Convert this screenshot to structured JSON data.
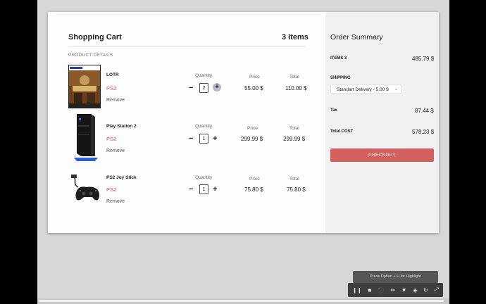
{
  "cart": {
    "title": "Shopping Cart",
    "items_count": "3 Items",
    "section_label": "PRODUCT DETAILS",
    "products": [
      {
        "name": "LOTR",
        "category": "PS2",
        "remove": "Remove",
        "quantity_label": "Quantity",
        "qty_minus": "−",
        "quantity": "2",
        "qty_plus": "+",
        "price_label": "Price",
        "price": "55.00 $",
        "total_label": "Total",
        "total": "110.00 $",
        "image_icon": "game-cover-image"
      },
      {
        "name": "Play Station 2",
        "category": "PS2",
        "remove": "Remove",
        "quantity_label": "Quantity",
        "qty_minus": "−",
        "quantity": "1",
        "qty_plus": "+",
        "price_label": "Price",
        "price": "299.99 $",
        "total_label": "Total",
        "total": "299.99 $",
        "image_icon": "console-image"
      },
      {
        "name": "PS2 Joy Stick",
        "category": "PS2",
        "remove": "Remove",
        "quantity_label": "Quantity",
        "qty_minus": "−",
        "quantity": "1",
        "qty_plus": "+",
        "price_label": "Price",
        "price": "75.80 $",
        "total_label": "Total",
        "total": "75.80 $",
        "image_icon": "controller-image"
      }
    ]
  },
  "summary": {
    "title": "Order Summary",
    "items_label": "ITEMS 3",
    "items_value": "485.79 $",
    "shipping_label": "SHIPPING",
    "shipping_option": "Standart Delivery - 5.00 $",
    "tax_label": "Tax",
    "tax_value": "87.44 $",
    "total_label": "Total COST",
    "total_value": "578.23 $",
    "checkout": "CHECKOUT"
  },
  "recorder": {
    "hint": "Press Option + H for Highlight",
    "buttons": [
      "pause-icon",
      "stop-icon",
      "microphone-icon",
      "pen-icon",
      "highlight-icon",
      "eraser-icon",
      "restart-icon",
      "expand-icon"
    ]
  },
  "colors": {
    "accent": "#d35f5f",
    "category": "#e05050",
    "summary_bg": "#f1f1f4"
  }
}
